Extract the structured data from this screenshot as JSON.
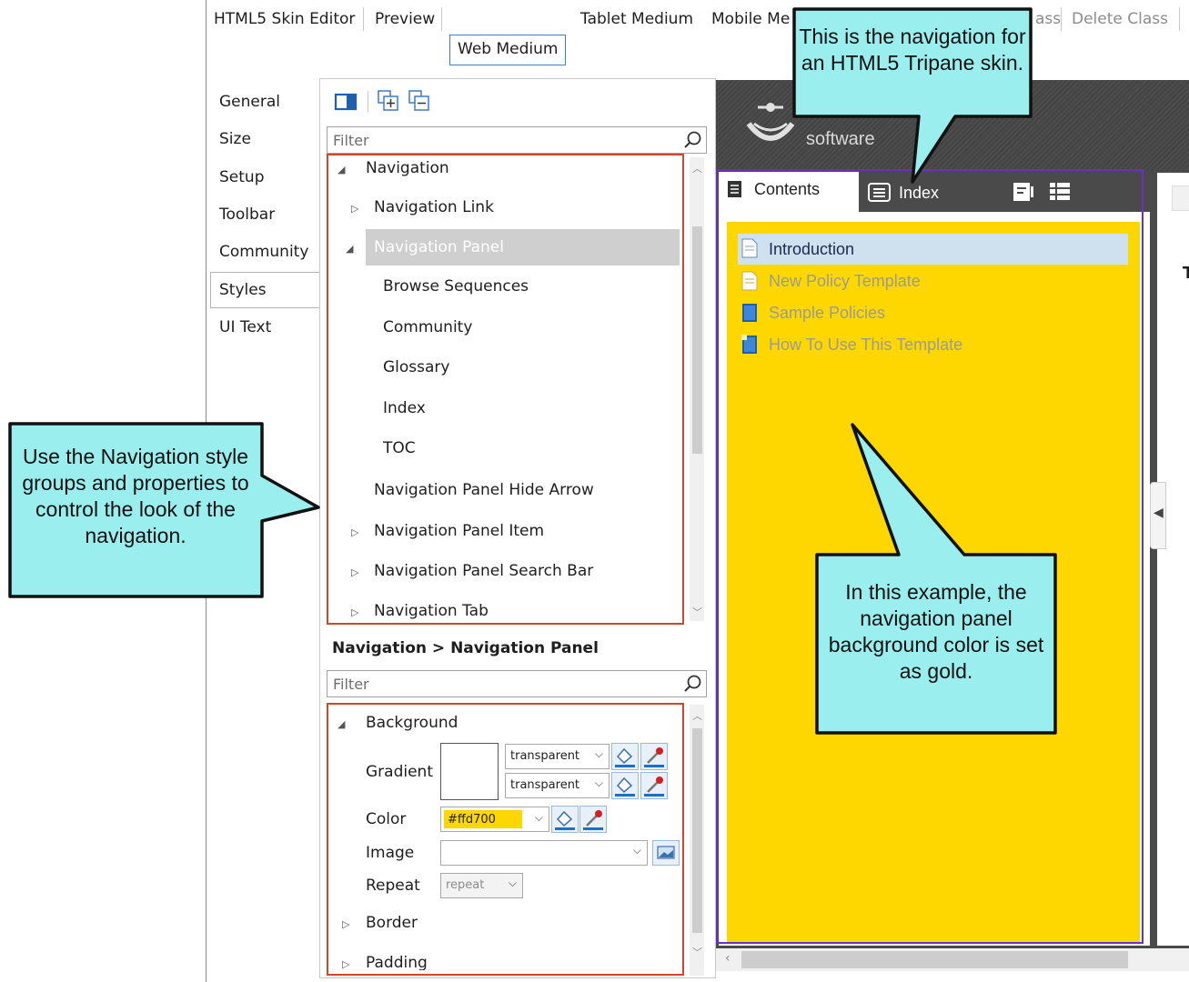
{
  "tabs": {
    "skin_editor": "HTML5 Skin Editor",
    "preview": "Preview",
    "web_medium": "Web Medium",
    "tablet_medium": "Tablet Medium",
    "mobile_medium": "Mobile Me",
    "add_class_partial": "ass",
    "delete_class": "Delete Class"
  },
  "left_nav": [
    "General",
    "Size",
    "Setup",
    "Toolbar",
    "Community",
    "Styles",
    "UI Text"
  ],
  "style_tree": {
    "filter_placeholder": "Filter",
    "items": {
      "navigation": "Navigation",
      "navigation_link": "Navigation Link",
      "navigation_panel": "Navigation Panel",
      "browse_sequences": "Browse Sequences",
      "community": "Community",
      "glossary": "Glossary",
      "index": "Index",
      "toc": "TOC",
      "panel_hide_arrow": "Navigation Panel Hide Arrow",
      "panel_item": "Navigation Panel Item",
      "panel_search_bar": "Navigation Panel Search Bar",
      "navigation_tab": "Navigation Tab"
    }
  },
  "properties": {
    "breadcrumb": "Navigation > Navigation Panel",
    "filter_placeholder": "Filter",
    "background": "Background",
    "gradient_label": "Gradient",
    "gradient_value_1": "transparent",
    "gradient_value_2": "transparent",
    "color_label": "Color",
    "color_value": "#ffd700",
    "image_label": "Image",
    "repeat_label": "Repeat",
    "repeat_value": "repeat",
    "border": "Border",
    "padding": "Padding"
  },
  "preview": {
    "logo_text": "software",
    "tab_contents": "Contents",
    "tab_index": "Index",
    "toc": [
      "Introduction",
      "New Policy Template",
      "Sample Policies",
      "How To Use This Template"
    ],
    "panel_color": "#ffd700"
  },
  "callouts": {
    "top": "This is the navigation for an HTML5 Tripane skin.",
    "left": "Use the Navigation style groups and properties to control the look of the navigation.",
    "center": "In this example, the navigation panel background color is set as gold."
  },
  "colors": {
    "callout_fill": "#9beeee",
    "highlight_box": "#d2462d",
    "preview_box": "#6a2fc8",
    "gold": "#ffd700"
  }
}
